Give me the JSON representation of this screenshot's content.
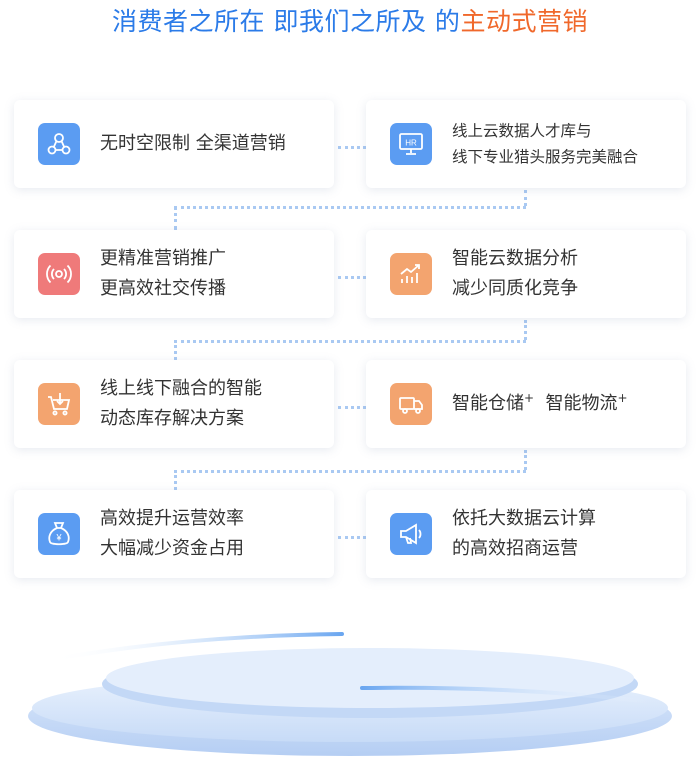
{
  "title": {
    "main": "消费者之所在 即我们之所及 的",
    "accent": "主动式",
    "tail": "营销"
  },
  "cards": [
    {
      "lines": [
        "无时空限制 全渠道营销"
      ]
    },
    {
      "lines": [
        "线上云数据人才库与",
        "线下专业猎头服务完美融合"
      ]
    },
    {
      "lines": [
        "更精准营销推广",
        "更高效社交传播"
      ]
    },
    {
      "lines": [
        "智能云数据分析",
        "减少同质化竞争"
      ]
    },
    {
      "lines": [
        "线上线下融合的智能",
        "动态库存解决方案"
      ]
    },
    {
      "parts": [
        "智能仓储",
        "+",
        "智能物流",
        "+"
      ]
    },
    {
      "lines": [
        "高效提升运营效率",
        "大幅减少资金占用"
      ]
    },
    {
      "lines": [
        "依托大数据云计算",
        "的高效招商运营"
      ]
    }
  ],
  "icons": [
    {
      "name": "network-icon",
      "color": "#5b9cf2"
    },
    {
      "name": "hr-monitor-icon",
      "color": "#5b9cf2",
      "label": "HR"
    },
    {
      "name": "broadcast-icon",
      "color": "#ef7a7a"
    },
    {
      "name": "growth-chart-icon",
      "color": "#f3a46f"
    },
    {
      "name": "shopping-cart-icon",
      "color": "#f3a46f"
    },
    {
      "name": "delivery-truck-icon",
      "color": "#f3a46f"
    },
    {
      "name": "money-bag-icon",
      "color": "#5b9cf2",
      "label": "¥"
    },
    {
      "name": "megaphone-icon",
      "color": "#5b9cf2"
    }
  ],
  "colors": {
    "title": "#2b7be8",
    "accent": "#f0682b",
    "connector": "#a9c9f2"
  }
}
